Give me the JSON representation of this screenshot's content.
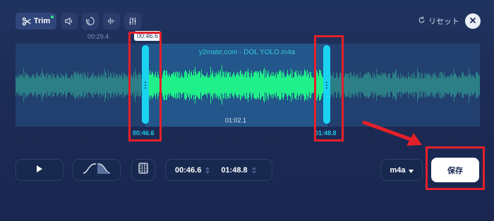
{
  "toolbar": {
    "trim_label": "Trim",
    "reset_label": "リセット",
    "icons": [
      "scissors-icon",
      "volume-icon",
      "speed-icon",
      "equalizer-icon",
      "mixer-icon",
      "refresh-icon",
      "close-icon"
    ]
  },
  "waveform": {
    "filename": "y2mate.com - DOL YOLO.m4a",
    "marker_time": "00:29.4",
    "tooltip_time": "00:46.6",
    "start_label": "00:46.6",
    "end_label": "01:48.8",
    "duration": "01:02.1"
  },
  "controls": {
    "start_time": "00:46.6",
    "end_time": "01:48.8",
    "format": "m4a",
    "save_label": "保存"
  },
  "colors": {
    "background": "#1c2b54",
    "selected_wave": "#1ff089",
    "unselected_wave": "#2c7f86",
    "handle": "#1ad3f0",
    "highlight_box": "#e5202a"
  }
}
